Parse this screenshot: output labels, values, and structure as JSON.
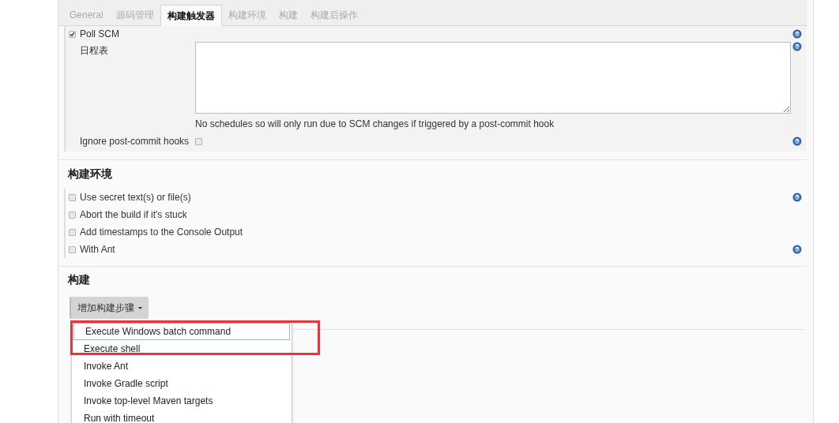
{
  "tabs": [
    {
      "label": "General",
      "selected": false
    },
    {
      "label": "源码管理",
      "selected": false
    },
    {
      "label": "构建触发器",
      "selected": true
    },
    {
      "label": "构建环境",
      "selected": false
    },
    {
      "label": "构建",
      "selected": false
    },
    {
      "label": "构建后操作",
      "selected": false
    }
  ],
  "poll_scm": {
    "label": "Poll SCM",
    "checked": true,
    "schedule_label": "日程表",
    "schedule_hint": "No schedules so will only run due to SCM changes if triggered by a post-commit hook",
    "ignore_label": "Ignore post-commit hooks",
    "ignore_checked": false
  },
  "build_env": {
    "title": "构建环境",
    "options": [
      {
        "label": "Use secret text(s) or file(s)",
        "checked": false,
        "help": true
      },
      {
        "label": "Abort the build if it's stuck",
        "checked": false,
        "help": false
      },
      {
        "label": "Add timestamps to the Console Output",
        "checked": false,
        "help": false
      },
      {
        "label": "With Ant",
        "checked": false,
        "help": true
      }
    ]
  },
  "build": {
    "title": "构建",
    "add_button": "增加构建步骤",
    "menu": [
      {
        "label": "Execute Windows batch command",
        "selected": true
      },
      {
        "label": "Execute shell",
        "selected": false
      },
      {
        "label": "Invoke Ant",
        "selected": false
      },
      {
        "label": "Invoke Gradle script",
        "selected": false
      },
      {
        "label": "Invoke top-level Maven targets",
        "selected": false
      },
      {
        "label": "Run with timeout",
        "selected": false
      }
    ]
  }
}
